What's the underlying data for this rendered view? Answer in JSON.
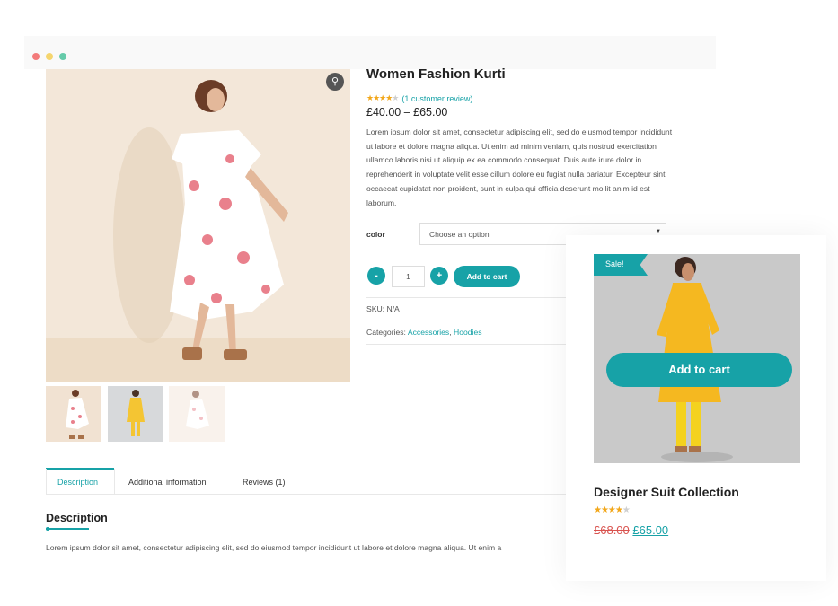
{
  "product": {
    "title": "Women Fashion Kurti",
    "rating_text": "(1 customer review)",
    "price": "£40.00 – £65.00",
    "description": "Lorem ipsum dolor sit amet, consectetur adipiscing elit, sed do eiusmod tempor incididunt ut labore et dolore magna aliqua. Ut enim ad minim veniam, quis nostrud exercitation ullamco laboris nisi ut aliquip ex ea commodo consequat. Duis aute irure dolor in reprehenderit in voluptate velit esse cillum dolore eu fugiat nulla pariatur. Excepteur sint occaecat cupidatat non proident, sunt in culpa qui officia deserunt mollit anim id est laborum.",
    "rating_stars": 4
  },
  "variation": {
    "color_label": "color",
    "select_value": "Choose an option"
  },
  "cart": {
    "minus": "-",
    "plus": "+",
    "quantity": "1",
    "add_label": "Add to cart"
  },
  "meta": {
    "sku": "SKU: N/A",
    "categories_label": "Categories:",
    "category_1": "Accessories",
    "separator": ",",
    "category_2": "Hoodies"
  },
  "tabs": [
    {
      "label": "Description"
    },
    {
      "label": "Additional information"
    },
    {
      "label": "Reviews (1)"
    }
  ],
  "description_section": {
    "title": "Description",
    "text": "Lorem ipsum dolor sit amet, consectetur adipiscing elit, sed do eiusmod tempor incididunt ut labore et dolore magna aliqua. Ut enim a"
  },
  "related_card": {
    "badge": "Sale!",
    "add_label": "Add to cart",
    "title": "Designer Suit Collection",
    "old_price": "£68.00",
    "new_price": "£65.00",
    "rating_stars": 4.5
  },
  "icons": {
    "zoom": "zoom-icon",
    "dropdown": "chevron-down-icon"
  },
  "colors": {
    "accent": "#17a2a7",
    "star": "#f2a71b",
    "old_price": "#d9534f"
  }
}
